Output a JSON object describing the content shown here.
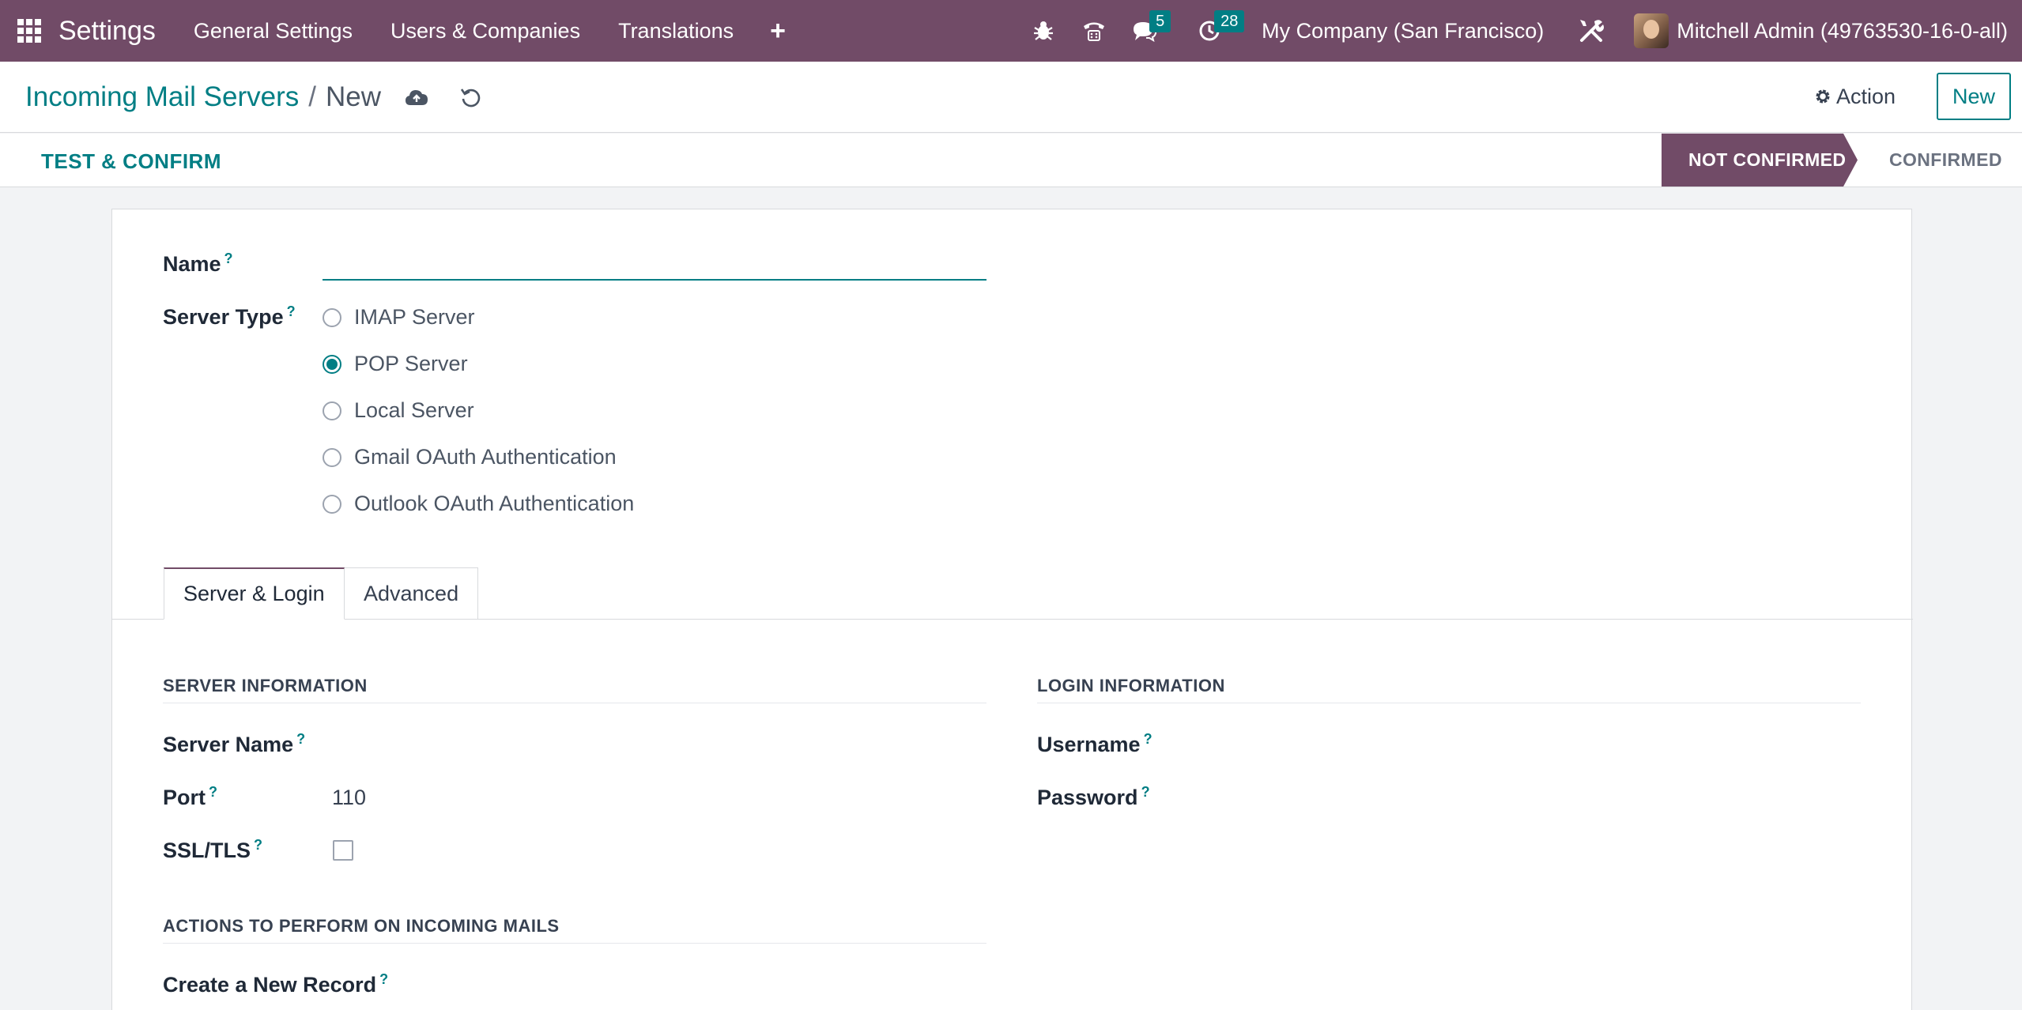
{
  "navbar": {
    "brand": "Settings",
    "menu": [
      "General Settings",
      "Users & Companies",
      "Translations"
    ],
    "chat_count": "5",
    "activity_count": "28",
    "company": "My Company (San Francisco)",
    "user": "Mitchell Admin (49763530-16-0-all)"
  },
  "breadcrumb": {
    "parent": "Incoming Mail Servers",
    "separator": "/",
    "current": "New"
  },
  "control": {
    "action_label": "Action",
    "new_label": "New"
  },
  "statusbar": {
    "test_button": "TEST & CONFIRM",
    "stages": [
      "NOT CONFIRMED",
      "CONFIRMED"
    ],
    "active_stage": "NOT CONFIRMED"
  },
  "form": {
    "name_label": "Name",
    "name_value": "",
    "help_mark": "?",
    "server_type_label": "Server Type",
    "server_types": [
      "IMAP Server",
      "POP Server",
      "Local Server",
      "Gmail OAuth Authentication",
      "Outlook OAuth Authentication"
    ],
    "selected_server_type": "POP Server",
    "tabs": [
      "Server & Login",
      "Advanced"
    ],
    "active_tab": "Server & Login",
    "server_info": {
      "title": "SERVER INFORMATION",
      "server_name_label": "Server Name",
      "port_label": "Port",
      "port_value": "110",
      "ssl_label": "SSL/TLS",
      "ssl_checked": false
    },
    "login_info": {
      "title": "LOGIN INFORMATION",
      "username_label": "Username",
      "password_label": "Password"
    },
    "actions": {
      "title": "ACTIONS TO PERFORM ON INCOMING MAILS",
      "create_record_label": "Create a New Record"
    }
  },
  "colors": {
    "brand": "#714b67",
    "accent": "#017e84"
  }
}
